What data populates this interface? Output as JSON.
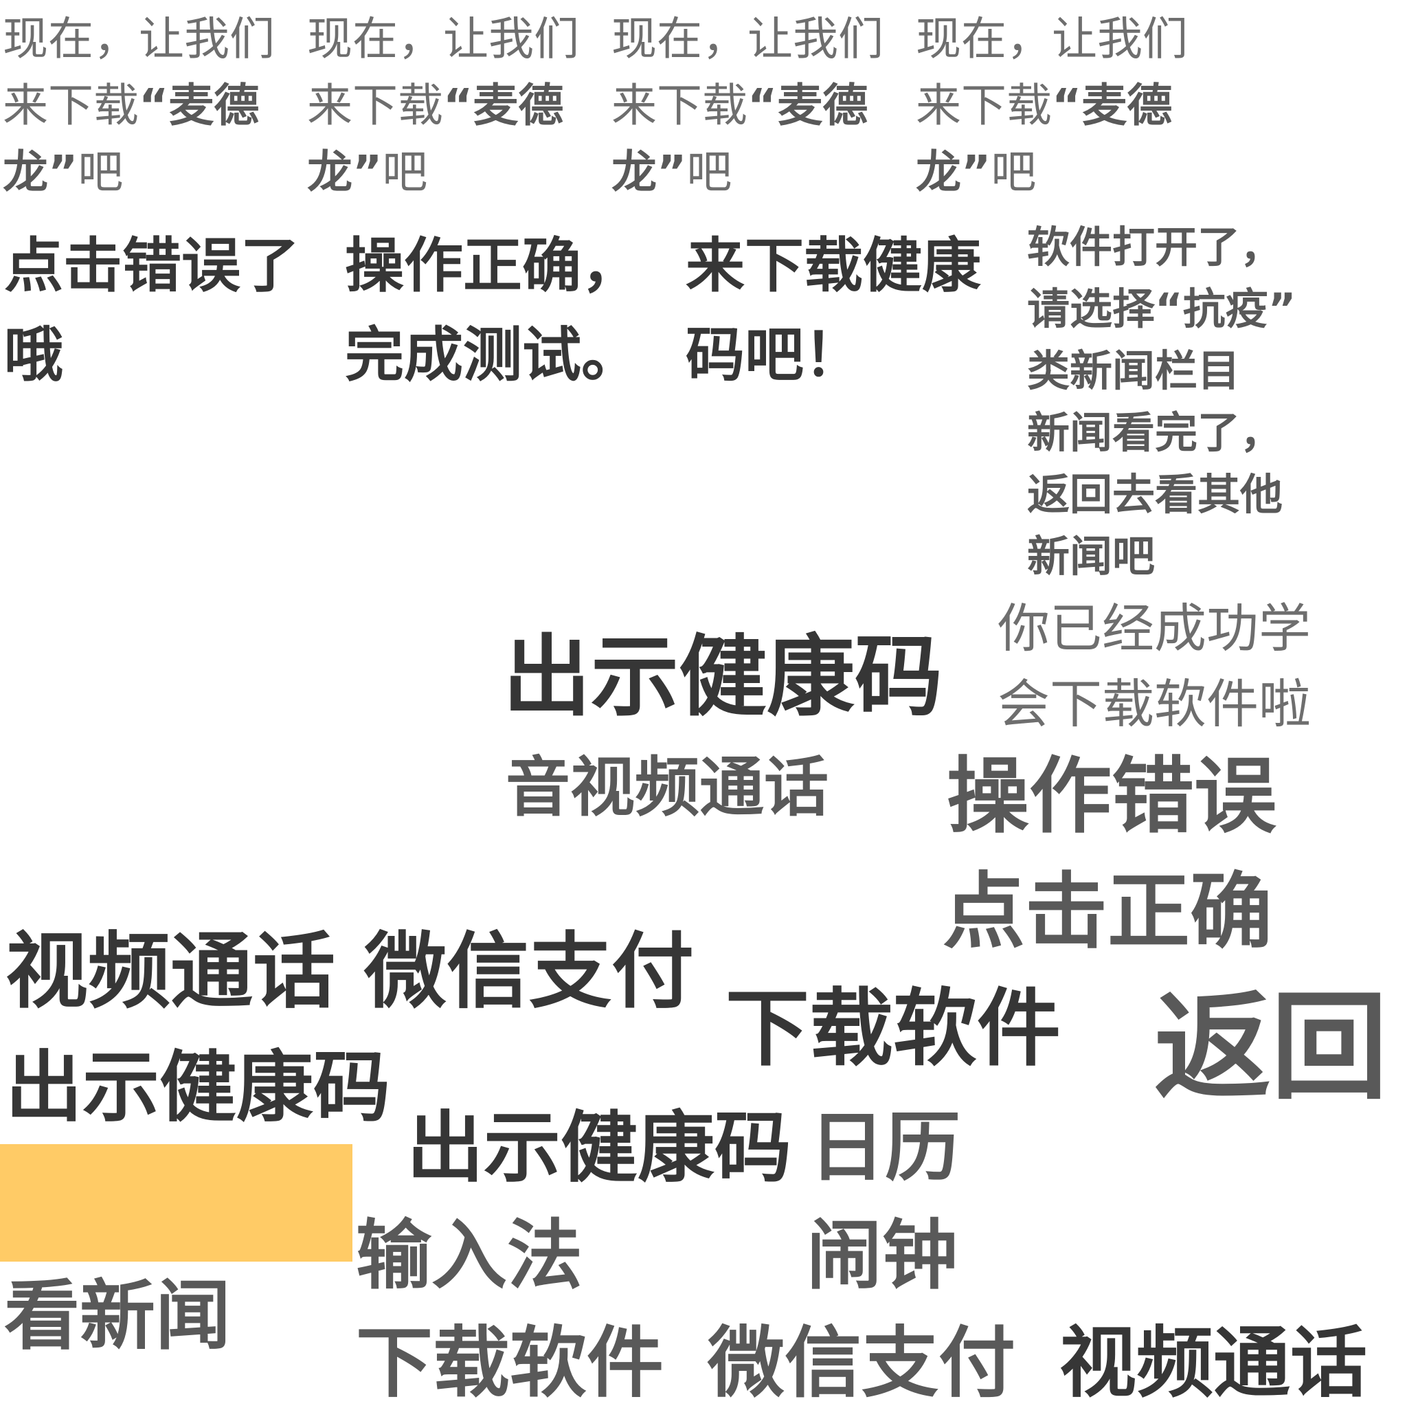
{
  "intro_repeat": {
    "line1": "现在，让我们",
    "line2_plain": "来下载",
    "line2_bold": "“麦德",
    "line3_bold": "龙”",
    "line3_plain": "吧"
  },
  "tiles": {
    "click_wrong": {
      "line1": "点击错误了",
      "line2": "哦"
    },
    "op_correct": {
      "line1": "操作正确，",
      "line2": "完成测试。"
    },
    "download_health": {
      "line1": "来下载健康",
      "line2": "码吧！"
    },
    "software_open": [
      "软件打开了，",
      "请选择“抗疫”",
      "类新闻栏目",
      "新闻看完了，",
      "返回去看其他",
      "新闻吧"
    ],
    "learned": {
      "line1": "你已经成功学",
      "line2": "会下载软件啦"
    }
  },
  "labels": {
    "show_health_code_1": "出示健康码",
    "av_call": "音视频通话",
    "op_wrong": "操作错误",
    "click_correct": "点击正确",
    "video_call_1": "视频通话",
    "wechat_pay_1": "微信支付",
    "download_software_1": "下载软件",
    "back": "返回",
    "show_health_code_2": "出示健康码",
    "show_health_code_3": "出示健康码",
    "calendar": "日历",
    "input_method": "输入法",
    "alarm": "闹钟",
    "read_news": "看新闻",
    "download_software_2": "下载软件",
    "wechat_pay_2": "微信支付",
    "video_call_2": "视频通话"
  },
  "colors": {
    "dark_text": "#363636",
    "mid_text": "#595959",
    "light_text": "#6e6e6e",
    "highlight": "#ffcb66"
  }
}
